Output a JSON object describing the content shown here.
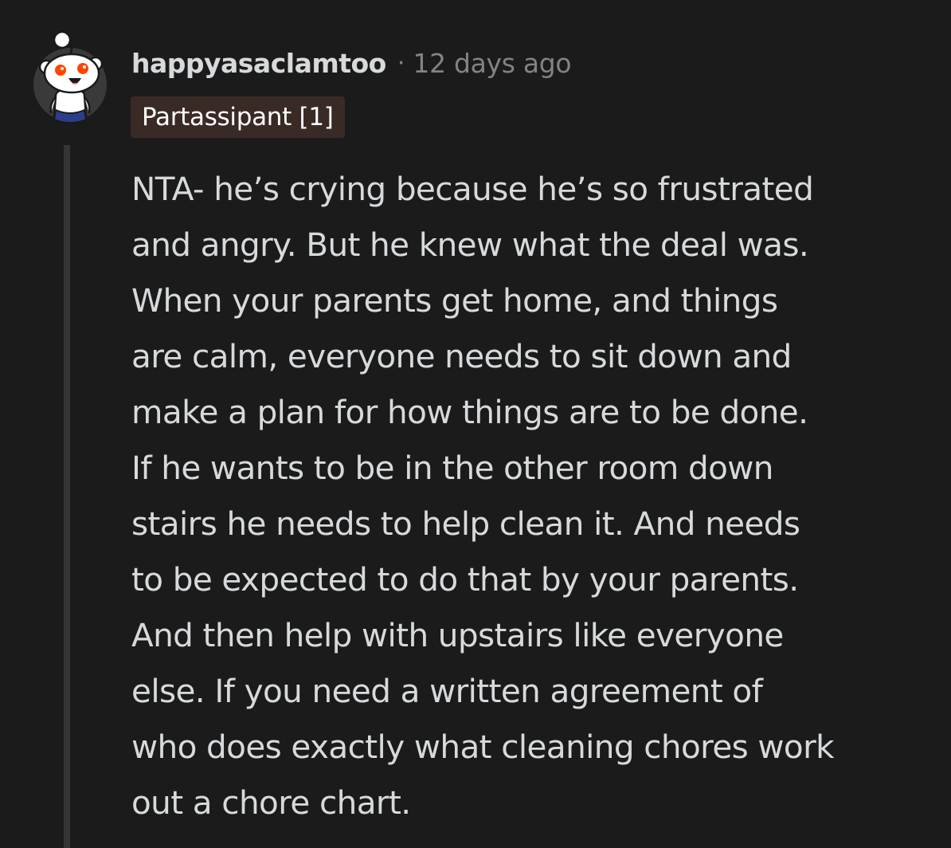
{
  "comment": {
    "username": "happyasaclamtoo",
    "separator": "·",
    "timestamp": "12 days ago",
    "flair": "Partassipant [1]",
    "avatar_icon": "snoo-avatar-icon",
    "body_lines": [
      "NTA- he’s crying because he’s so frustrated",
      "and angry. But he knew what the deal was.",
      "When your parents get home, and things",
      "are calm, everyone needs to sit down and",
      "make a plan for how things are to be done.",
      "If he wants to be in the other room down",
      "stairs he needs to help clean it. And needs",
      "to be expected to do that by your parents.",
      "And then help with upstairs like everyone",
      "else. If you need a written agreement of",
      "who does exactly what cleaning chores work",
      "out a chore chart."
    ]
  },
  "colors": {
    "background": "#1b1b1b",
    "text": "#d7dadc",
    "muted": "#818384",
    "flair_bg": "#3a2a25",
    "thread_line": "#343536"
  }
}
